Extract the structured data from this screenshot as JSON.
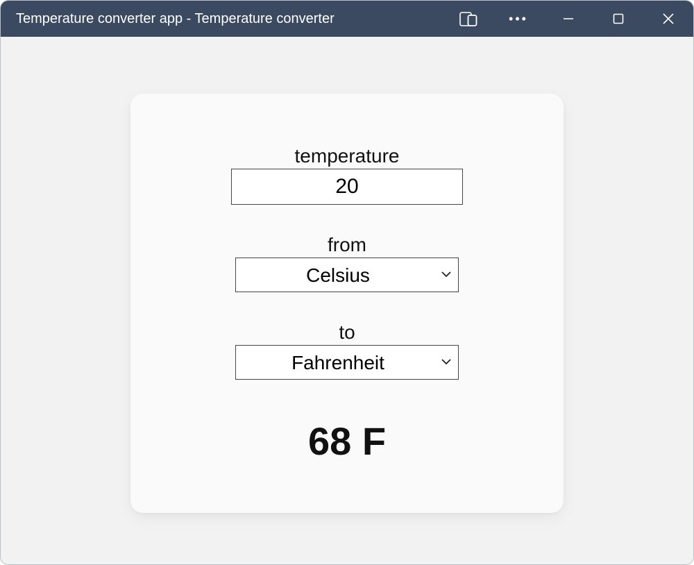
{
  "window": {
    "title": "Temperature converter app - Temperature converter"
  },
  "form": {
    "temperature_label": "temperature",
    "temperature_value": "20",
    "from_label": "from",
    "from_value": "Celsius",
    "to_label": "to",
    "to_value": "Fahrenheit"
  },
  "result": "68 F"
}
